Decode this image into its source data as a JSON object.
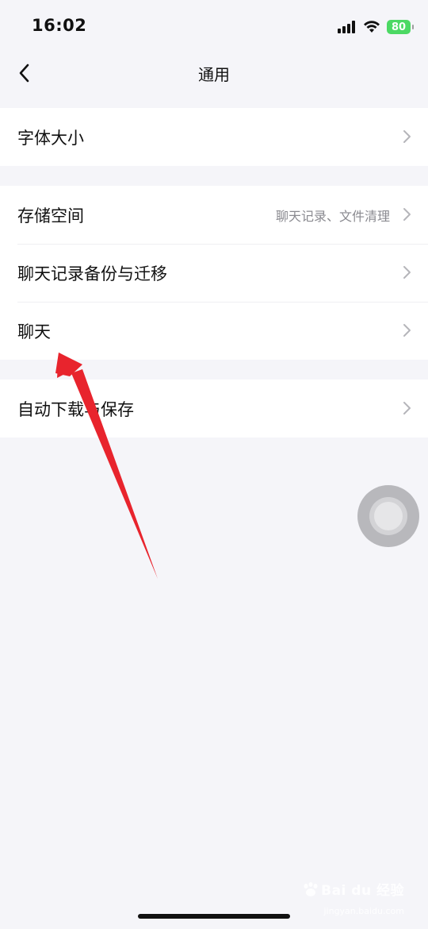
{
  "status_bar": {
    "time": "16:02",
    "battery": "80"
  },
  "nav": {
    "title": "通用"
  },
  "groups": [
    {
      "items": [
        {
          "label": "字体大小",
          "value": ""
        }
      ]
    },
    {
      "items": [
        {
          "label": "存储空间",
          "value": "聊天记录、文件清理"
        },
        {
          "label": "聊天记录备份与迁移",
          "value": ""
        },
        {
          "label": "聊天",
          "value": ""
        }
      ]
    },
    {
      "items": [
        {
          "label": "自动下载与保存",
          "value": ""
        }
      ]
    }
  ],
  "watermark": {
    "brand": "Bai du 经验",
    "url": "jingyan.baidu.com"
  },
  "colors": {
    "background": "#f5f5f9",
    "row_background": "#ffffff",
    "battery_green": "#4cd964",
    "annotation_red": "#e8242d",
    "secondary_text": "#8a8a90"
  },
  "icons": {
    "back": "chevron-left-icon",
    "row_arrow": "chevron-right-icon",
    "signal": "signal-icon",
    "wifi": "wifi-icon"
  }
}
